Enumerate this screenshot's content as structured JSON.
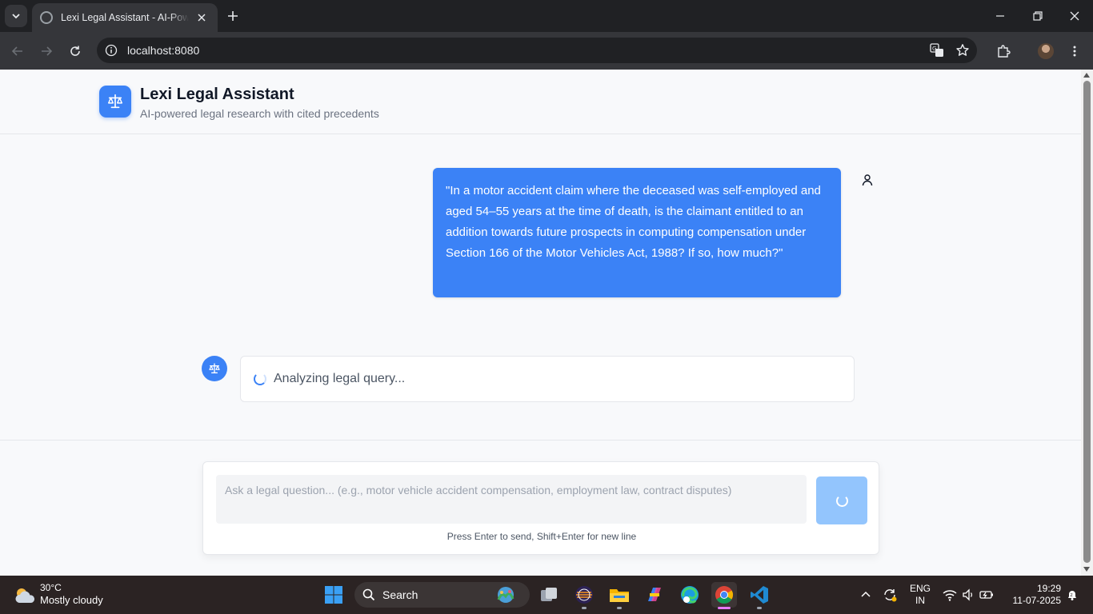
{
  "browser": {
    "tab_title": "Lexi Legal Assistant - AI-Powered Legal Research",
    "url": "localhost:8080"
  },
  "app": {
    "title": "Lexi Legal Assistant",
    "subtitle": "AI-powered legal research with cited precedents",
    "accent_color": "#3b82f6"
  },
  "conversation": {
    "user_message": "\"In a motor accident claim where the deceased was self-employed and aged 54–55 years at the time of death, is the claimant entitled to an addition towards future prospects in computing compensation under Section 166 of the Motor Vehicles Act, 1988? If so, how much?\"",
    "assistant_status": "Analyzing legal query..."
  },
  "composer": {
    "placeholder": "Ask a legal question... (e.g., motor vehicle accident compensation, employment law, contract disputes)",
    "hint": "Press Enter to send, Shift+Enter for new line"
  },
  "taskbar": {
    "weather_temp": "30°C",
    "weather_desc": "Mostly cloudy",
    "search_label": "Search",
    "language_line1": "ENG",
    "language_line2": "IN",
    "time": "19:29",
    "date": "11-07-2025"
  }
}
